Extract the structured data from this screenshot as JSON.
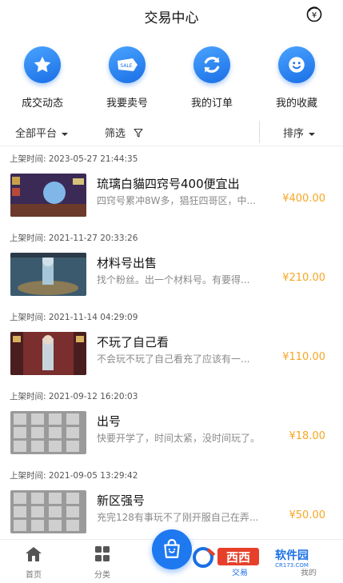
{
  "header": {
    "title": "交易中心"
  },
  "quick_actions": [
    {
      "label": "成交动态",
      "icon": "star-icon"
    },
    {
      "label": "我要卖号",
      "icon": "sale-tag-icon"
    },
    {
      "label": "我的订单",
      "icon": "refresh-icon"
    },
    {
      "label": "我的收藏",
      "icon": "smiley-icon"
    }
  ],
  "filters": {
    "platform": "全部平台",
    "filter": "筛选",
    "sort": "排序"
  },
  "listings": [
    {
      "time": "上架时间: 2023-05-27 21:44:35",
      "title": "琉璃白貓四窍号400便宜出",
      "desc": "四窍号累冲8W多，猖狂四哥区，中...",
      "price": "¥400.00"
    },
    {
      "time": "上架时间: 2021-11-27 20:33:26",
      "title": "材料号出售",
      "desc": "找个粉丝。出一个材料号。有要得...",
      "price": "¥210.00"
    },
    {
      "time": "上架时间: 2021-11-14 04:29:09",
      "title": "不玩了自己看",
      "desc": "不会玩不玩了自己看充了应该有一...",
      "price": "¥110.00"
    },
    {
      "time": "上架时间: 2021-09-12 16:20:03",
      "title": "出号",
      "desc": "快要开学了，时间太紧，没时间玩了。",
      "price": "¥18.00"
    },
    {
      "time": "上架时间: 2021-09-05 13:29:42",
      "title": "新区强号",
      "desc": "充完128有事玩不了刚开服自己在弄...",
      "price": "¥50.00"
    }
  ],
  "tabbar": {
    "home": "首页",
    "category": "分类",
    "trade": "交易",
    "mine": "我的"
  },
  "watermark": {
    "text": "西西软件园",
    "sub": "CR173.COM"
  },
  "colors": {
    "accent": "#1a6fe5",
    "price": "#f5a623"
  }
}
